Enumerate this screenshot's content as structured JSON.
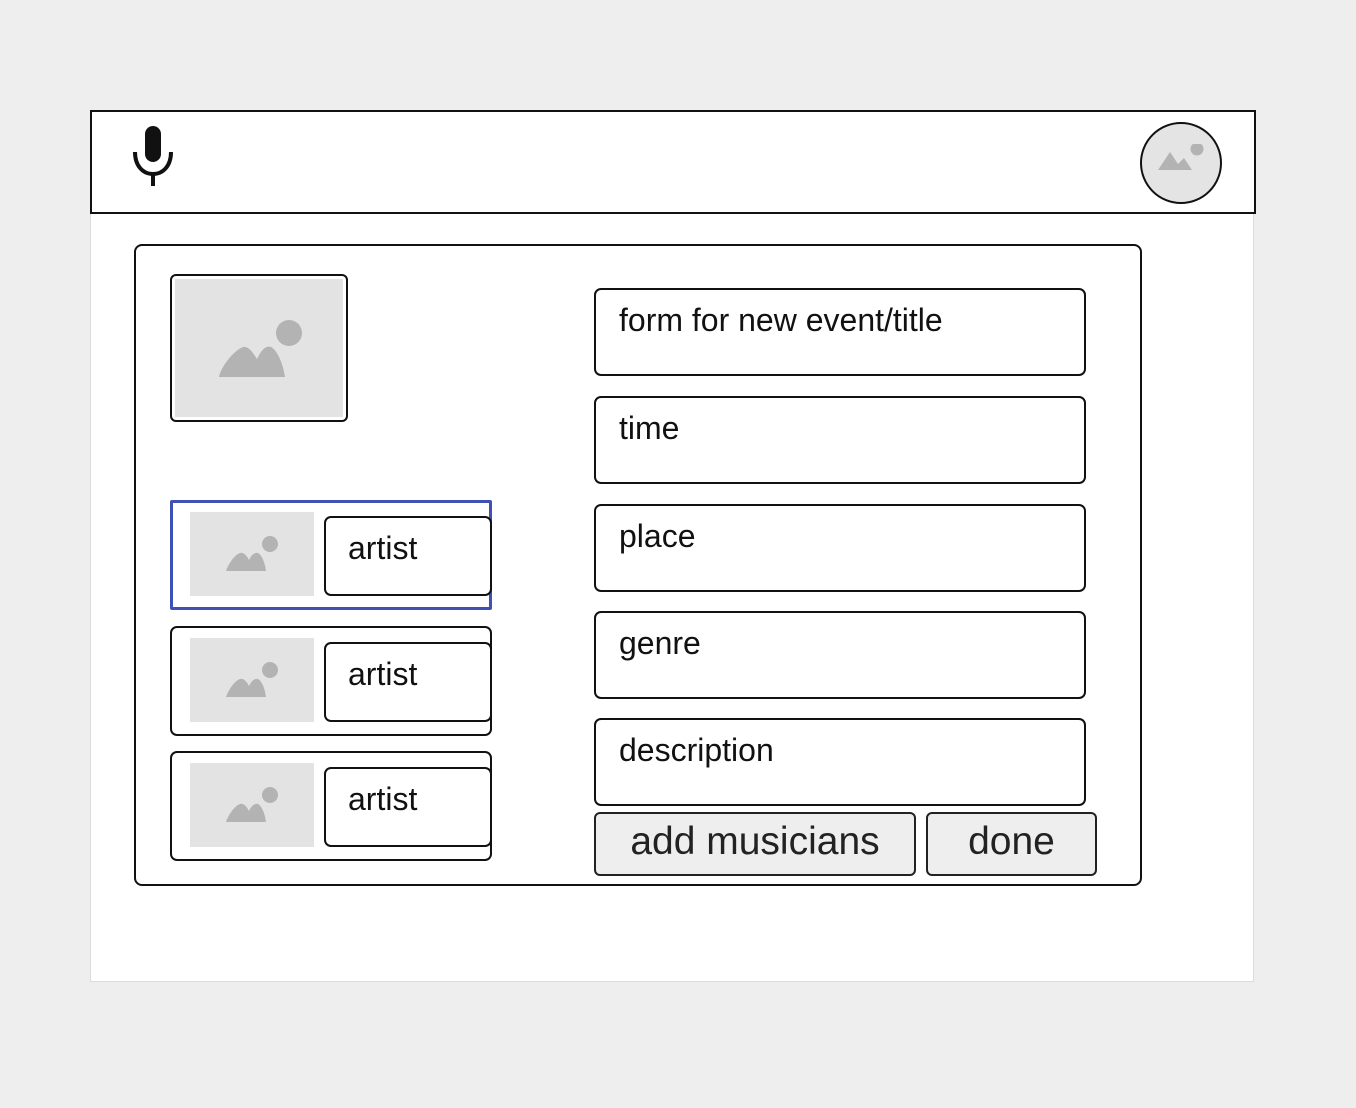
{
  "header": {
    "mic_icon": "microphone-icon",
    "avatar_icon": "image-placeholder-icon"
  },
  "form": {
    "image_icon": "image-placeholder-icon",
    "artists": [
      {
        "label": "artist",
        "selected": true
      },
      {
        "label": "artist",
        "selected": false
      },
      {
        "label": "artist",
        "selected": false
      }
    ],
    "fields": {
      "title": "form for new event/title",
      "time": "time",
      "place": "place",
      "genre": "genre",
      "description": "description"
    },
    "buttons": {
      "add_musicians": "add musicians",
      "done": "done"
    }
  },
  "colors": {
    "selection": "#3f51b5",
    "placeholder": "#e3e3e3",
    "placeholder_glyph": "#b3b3b3",
    "border": "#111111",
    "button_bg": "#eeeeee"
  }
}
